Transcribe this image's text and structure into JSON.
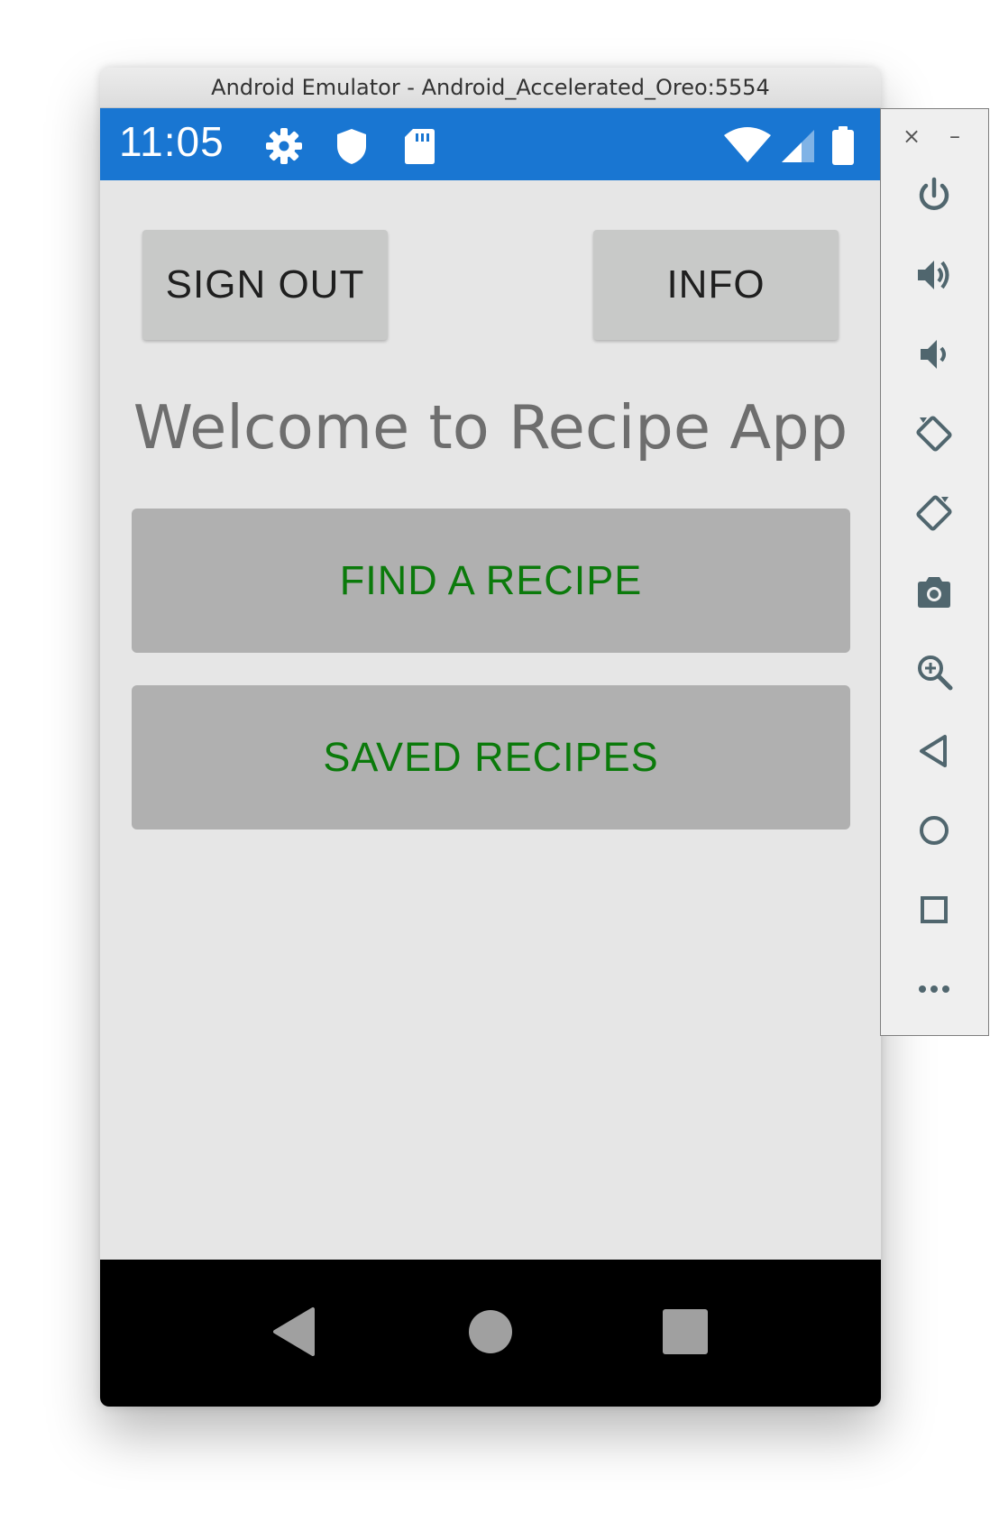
{
  "window": {
    "title": "Android Emulator - Android_Accelerated_Oreo:5554"
  },
  "status_bar": {
    "time": "11:05",
    "left_icons": [
      "gear-icon",
      "shield-icon",
      "sd-card-icon"
    ],
    "right_icons": [
      "wifi-icon",
      "cell-signal-icon",
      "battery-icon"
    ],
    "background_color": "#1976d2"
  },
  "app": {
    "sign_out_label": "SIGN OUT",
    "info_label": "INFO",
    "welcome_text": "Welcome to Recipe App",
    "find_recipe_label": "FIND A RECIPE",
    "saved_recipes_label": "SAVED RECIPES",
    "accent_text_color": "#0b7a0b",
    "background_color": "#e6e6e6"
  },
  "nav_bar": {
    "buttons": [
      "back-icon",
      "home-icon",
      "recents-icon"
    ]
  },
  "emulator_toolbar": {
    "window_controls": {
      "close_label": "×",
      "minimize_label": "–"
    },
    "tools": [
      "power-icon",
      "volume-up-icon",
      "volume-down-icon",
      "rotate-left-icon",
      "rotate-right-icon",
      "camera-icon",
      "zoom-icon",
      "back-icon",
      "home-icon",
      "overview-icon",
      "more-icon"
    ]
  }
}
